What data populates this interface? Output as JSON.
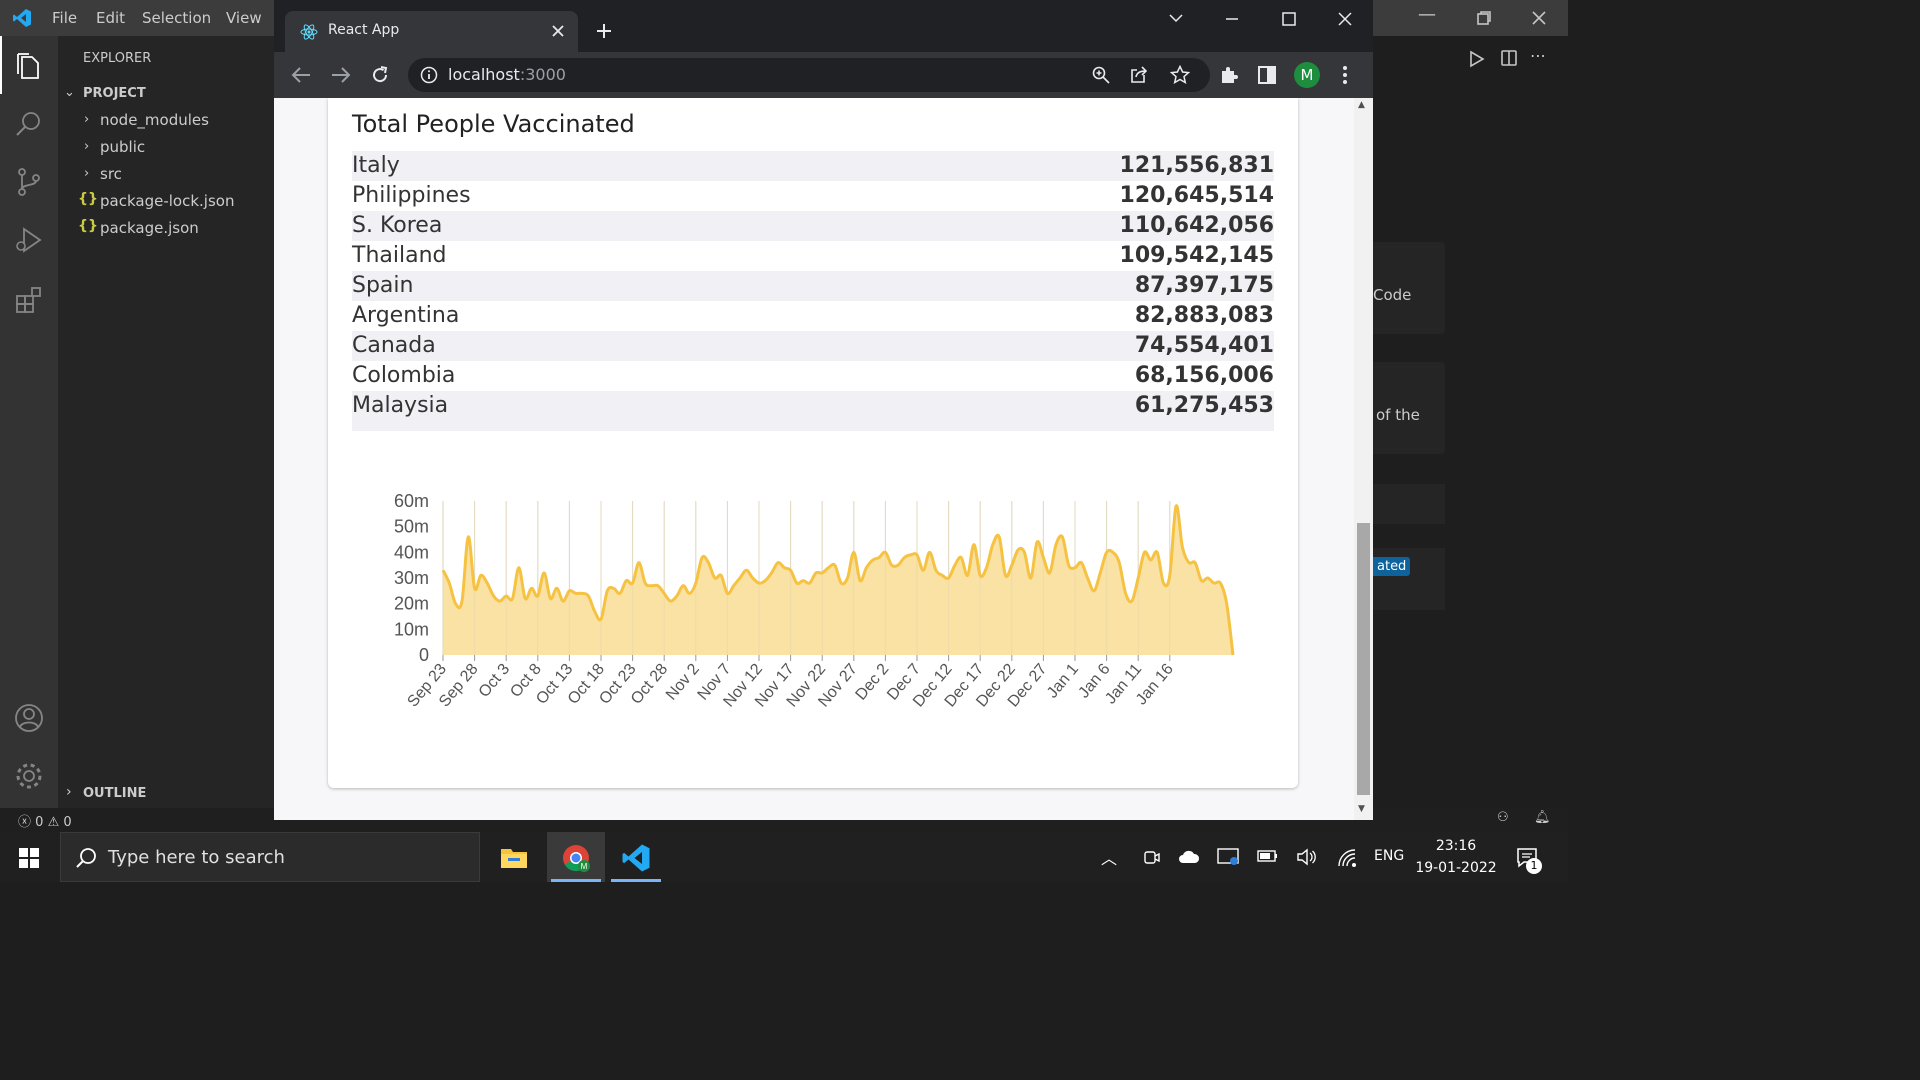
{
  "vscode": {
    "menu": [
      "File",
      "Edit",
      "Selection",
      "View"
    ],
    "explorer_title": "EXPLORER",
    "project_label": "PROJECT",
    "tree": [
      {
        "label": "node_modules",
        "kind": "folder"
      },
      {
        "label": "public",
        "kind": "folder"
      },
      {
        "label": "src",
        "kind": "folder"
      },
      {
        "label": "package-lock.json",
        "kind": "json"
      },
      {
        "label": "package.json",
        "kind": "json"
      }
    ],
    "outline_label": "OUTLINE",
    "right_panel_snippets": [
      "Code",
      "of the",
      "ated"
    ],
    "status": {
      "errors": "0",
      "warnings": "0"
    }
  },
  "browser": {
    "tab_title": "React App",
    "url_host": "localhost",
    "url_port": ":3000",
    "profile_initial": "M",
    "colors": {
      "profile": "#1e8e3e",
      "chart_line": "#f5c242",
      "chart_fill": "#f9df9b"
    }
  },
  "page": {
    "table_title": "Total People Vaccinated",
    "rows": [
      {
        "country": "Italy",
        "value": "121,556,831"
      },
      {
        "country": "Philippines",
        "value": "120,645,514"
      },
      {
        "country": "S. Korea",
        "value": "110,642,056"
      },
      {
        "country": "Thailand",
        "value": "109,542,145"
      },
      {
        "country": "Spain",
        "value": "87,397,175"
      },
      {
        "country": "Argentina",
        "value": "82,883,083"
      },
      {
        "country": "Canada",
        "value": "74,554,401"
      },
      {
        "country": "Colombia",
        "value": "68,156,006"
      },
      {
        "country": "Malaysia",
        "value": "61,275,453"
      }
    ]
  },
  "chart_data": {
    "type": "area",
    "title": "",
    "xlabel": "",
    "ylabel": "",
    "ylim": [
      0,
      60
    ],
    "y_ticks": [
      "60m",
      "50m",
      "40m",
      "30m",
      "20m",
      "10m",
      "0"
    ],
    "y_tick_values": [
      60,
      50,
      40,
      30,
      20,
      10,
      0
    ],
    "x_tick_labels": [
      "Sep 23",
      "Sep 28",
      "Oct 3",
      "Oct 8",
      "Oct 13",
      "Oct 18",
      "Oct 23",
      "Oct 28",
      "Nov 2",
      "Nov 7",
      "Nov 12",
      "Nov 17",
      "Nov 22",
      "Nov 27",
      "Dec 2",
      "Dec 7",
      "Dec 12",
      "Dec 17",
      "Dec 22",
      "Dec 27",
      "Jan 1",
      "Jan 6",
      "Jan 11",
      "Jan 16"
    ],
    "series": [
      {
        "values": [
          33,
          28,
          20,
          21,
          46,
          26,
          31,
          28,
          23,
          21,
          23,
          22,
          34,
          22,
          26,
          23,
          32,
          22,
          26,
          21,
          25,
          24,
          24,
          23,
          17,
          14,
          25,
          26,
          24,
          29,
          28,
          36,
          28,
          27,
          27,
          24,
          21,
          23,
          27,
          24,
          28,
          38,
          36,
          30,
          31,
          24,
          27,
          30,
          33,
          30,
          28,
          29,
          32,
          36,
          34,
          33,
          28,
          29,
          28,
          32,
          32,
          34,
          35,
          28,
          30,
          40,
          29,
          34,
          37,
          38,
          40,
          35,
          35,
          38,
          39,
          39,
          33,
          40,
          33,
          31,
          30,
          35,
          38,
          31,
          43,
          31,
          34,
          43,
          46,
          31,
          35,
          41,
          40,
          30,
          44,
          38,
          32,
          43,
          46,
          35,
          34,
          36,
          30,
          25,
          32,
          40,
          40,
          36,
          24,
          21,
          30,
          40,
          37,
          40,
          28,
          31,
          58,
          42,
          36,
          36,
          29,
          30,
          28,
          28,
          20,
          0
        ]
      }
    ]
  },
  "taskbar": {
    "search_placeholder": "Type here to search",
    "lang": "ENG",
    "time": "23:16",
    "date": "19-01-2022",
    "notification_count": "1"
  }
}
